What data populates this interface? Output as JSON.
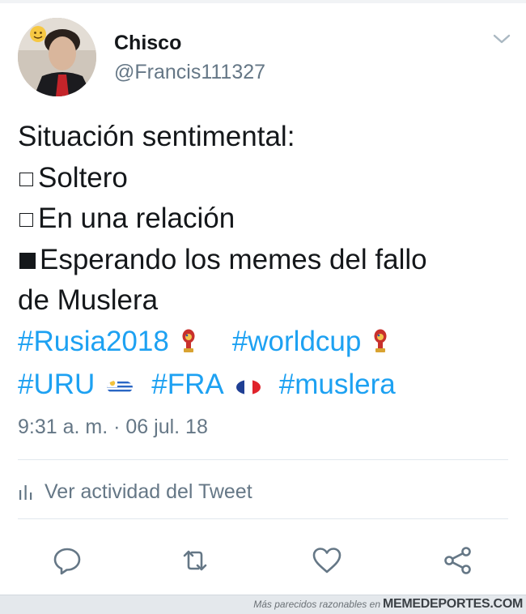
{
  "tweet": {
    "display_name": "Chisco",
    "username": "@Francis111327",
    "text_lines": {
      "heading": "Situación sentimental:",
      "option_1": "Soltero",
      "option_2": "En una relación",
      "option_3a": "Esperando los memes del fallo",
      "option_3b": "de Muslera"
    },
    "option_states": [
      "unchecked",
      "unchecked",
      "checked"
    ],
    "hashtags": {
      "rusia": "#Rusia2018",
      "worldcup": "#worldcup",
      "uru": "#URU",
      "fra": "#FRA",
      "muslera": "#muslera"
    },
    "hashtag_emojis": [
      "world-cup-trophy",
      "world-cup-trophy",
      "uruguay-flag",
      "france-flag"
    ],
    "timestamp": "9:31 a. m. · 06 jul. 18",
    "activity_label": "Ver actividad del Tweet",
    "actions": [
      "reply-icon",
      "retweet-icon",
      "like-icon",
      "share-icon"
    ]
  },
  "watermark": {
    "prefix": "Más parecidos razonables en",
    "brand": "MEMEDEPORTES.COM"
  },
  "colors": {
    "text": "#14171a",
    "secondary": "#657786",
    "link": "#1da1f2",
    "divider": "#e1e8ed"
  }
}
